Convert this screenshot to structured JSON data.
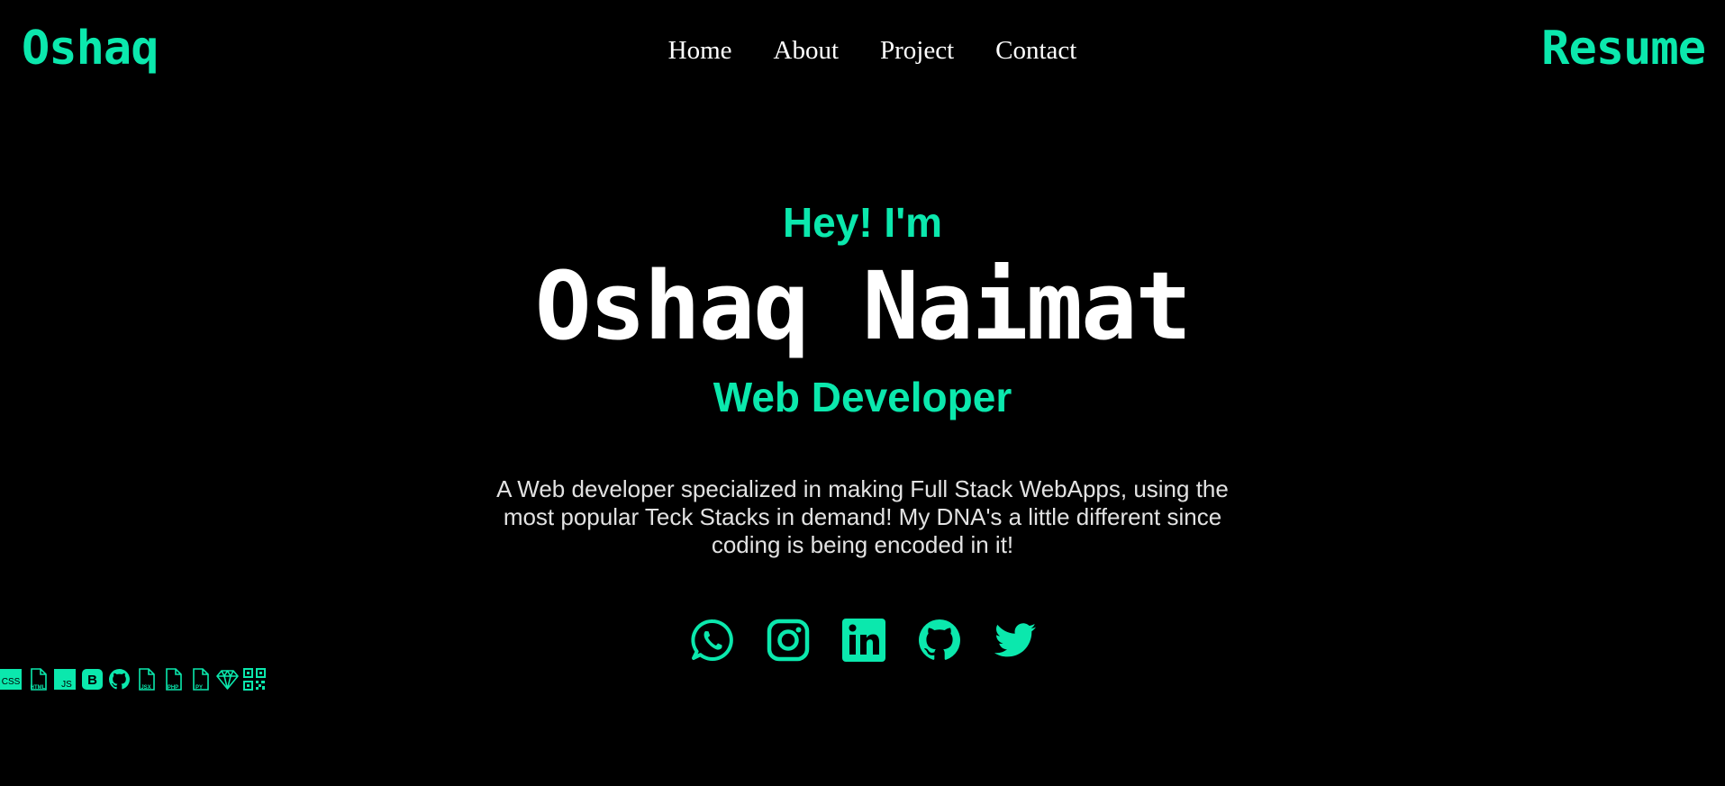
{
  "header": {
    "brand": "Oshaq",
    "nav": [
      {
        "label": "Home"
      },
      {
        "label": "About"
      },
      {
        "label": "Project"
      },
      {
        "label": "Contact"
      }
    ],
    "resume_label": "Resume"
  },
  "hero": {
    "greeting": "Hey! I'm",
    "name": "Oshaq Naimat",
    "role": "Web Developer",
    "description": "A Web developer specialized in making Full Stack WebApps, using the most popular Teck Stacks in demand! My DNA's a little different since coding is being encoded in it!"
  },
  "socials": [
    {
      "icon": "whatsapp-icon"
    },
    {
      "icon": "instagram-icon"
    },
    {
      "icon": "linkedin-icon"
    },
    {
      "icon": "github-icon"
    },
    {
      "icon": "twitter-icon"
    }
  ],
  "skills": [
    {
      "icon": "css-icon",
      "label": "CSS"
    },
    {
      "icon": "html-file-icon",
      "label": "HTML"
    },
    {
      "icon": "js-icon",
      "label": "JS"
    },
    {
      "icon": "bootstrap-icon",
      "label": "B"
    },
    {
      "icon": "github-small-icon"
    },
    {
      "icon": "jsx-file-icon",
      "label": "JSX"
    },
    {
      "icon": "php-file-icon",
      "label": "PHP"
    },
    {
      "icon": "python-file-icon",
      "label": "PY"
    },
    {
      "icon": "ruby-gem-icon"
    },
    {
      "icon": "qr-code-icon"
    }
  ],
  "colors": {
    "accent": "#0be8ad",
    "background": "#000000",
    "text": "#ffffff"
  }
}
